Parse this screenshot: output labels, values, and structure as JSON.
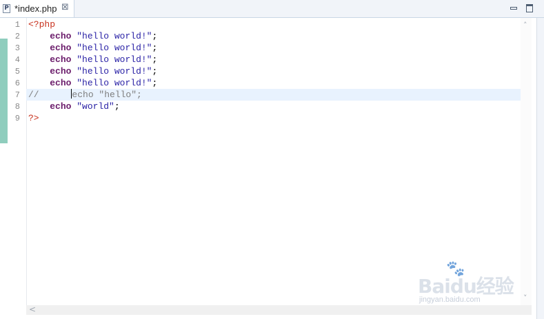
{
  "tab": {
    "file_icon": "P",
    "title": "*index.php",
    "close_glyph": "⊠"
  },
  "window": {
    "minimize_icon": "minimize-icon",
    "maximize_icon": "maximize-icon"
  },
  "editor": {
    "line_numbers": [
      "1",
      "2",
      "3",
      "4",
      "5",
      "6",
      "7",
      "8",
      "9"
    ],
    "lines": {
      "l1": {
        "tag": "<?php"
      },
      "l2": {
        "kw": "echo",
        "str": "\"hello world!\"",
        "end": ";"
      },
      "l3": {
        "kw": "echo",
        "str": "\"hello world!\"",
        "end": ";"
      },
      "l4": {
        "kw": "echo",
        "str": "\"hello world!\"",
        "end": ";"
      },
      "l5": {
        "kw": "echo",
        "str": "\"hello world!\"",
        "end": ";"
      },
      "l6": {
        "kw": "echo",
        "str": "\"hello world!\"",
        "end": ";"
      },
      "l7": {
        "comment_prefix": "//",
        "comment_body": "echo \"hello\";"
      },
      "l8": {
        "kw": "echo",
        "str": "\"world\"",
        "end": ";"
      },
      "l9": {
        "tag": "?>"
      }
    },
    "current_line": "7"
  },
  "scroll": {
    "up": "˄",
    "down": "˅",
    "left": "<"
  },
  "watermark": {
    "brand": "Baidu经验",
    "url": "jingyan.baidu.com",
    "paw": "🐾"
  },
  "colors": {
    "tag": "#c8321e",
    "keyword": "#6a1b6a",
    "string": "#2a22a6",
    "comment": "#7e7e7e",
    "change_bar": "#8fcdbd",
    "current_line": "#e8f2fe"
  }
}
